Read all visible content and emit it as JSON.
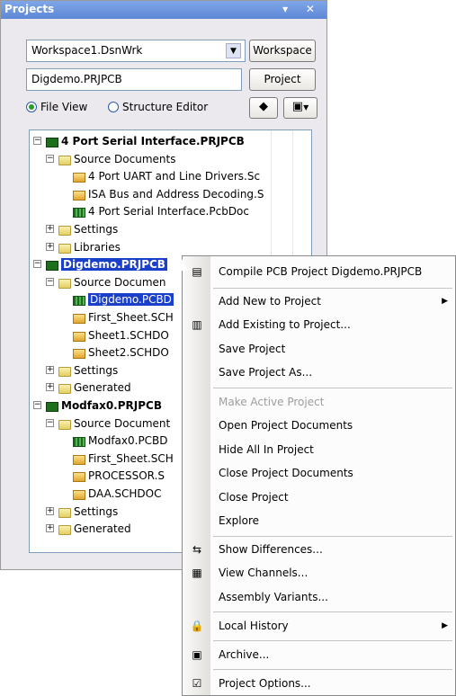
{
  "panel": {
    "title": "Projects",
    "controls": "▾ ✕",
    "workspace_value": "Workspace1.DsnWrk",
    "workspace_button": "Workspace",
    "project_value": "Digdemo.PRJPCB",
    "project_button": "Project",
    "radio_file_view": "File View",
    "radio_structure_editor": "Structure Editor",
    "file_view_selected": true
  },
  "tree": [
    {
      "label": "4 Port Serial Interface.PRJPCB",
      "icon": "prj",
      "level": 0,
      "toggle": "−",
      "bold": true
    },
    {
      "label": "Source Documents",
      "icon": "folder",
      "level": 1,
      "toggle": "−"
    },
    {
      "label": "4 Port UART and Line Drivers.Sc",
      "icon": "sch",
      "level": 2
    },
    {
      "label": "ISA Bus and Address Decoding.S",
      "icon": "sch",
      "level": 2
    },
    {
      "label": "4 Port Serial Interface.PcbDoc",
      "icon": "pcb",
      "level": 2
    },
    {
      "label": "Settings",
      "icon": "folder",
      "level": 1,
      "toggle": "+"
    },
    {
      "label": "Libraries",
      "icon": "folder",
      "level": 1,
      "toggle": "+"
    },
    {
      "label": "Digdemo.PRJPCB",
      "icon": "prj",
      "level": 0,
      "toggle": "−",
      "bold": true,
      "selected": true
    },
    {
      "label": "Source Documen",
      "icon": "folder",
      "level": 1,
      "toggle": "−"
    },
    {
      "label": "Digdemo.PCBD",
      "icon": "pcb",
      "level": 2,
      "selected": true
    },
    {
      "label": "First_Sheet.SCH",
      "icon": "sch",
      "level": 2
    },
    {
      "label": "Sheet1.SCHDO",
      "icon": "sch",
      "level": 2
    },
    {
      "label": "Sheet2.SCHDO",
      "icon": "sch",
      "level": 2
    },
    {
      "label": "Settings",
      "icon": "folder",
      "level": 1,
      "toggle": "+"
    },
    {
      "label": "Generated",
      "icon": "folder",
      "level": 1,
      "toggle": "+"
    },
    {
      "label": "Modfax0.PRJPCB",
      "icon": "prj",
      "level": 0,
      "toggle": "−",
      "bold": true
    },
    {
      "label": "Source Document",
      "icon": "folder",
      "level": 1,
      "toggle": "−"
    },
    {
      "label": "Modfax0.PCBD",
      "icon": "pcb",
      "level": 2
    },
    {
      "label": "First_Sheet.SCH",
      "icon": "sch",
      "level": 2
    },
    {
      "label": "PROCESSOR.S",
      "icon": "sch",
      "level": 2
    },
    {
      "label": "DAA.SCHDOC",
      "icon": "sch",
      "level": 2
    },
    {
      "label": "Settings",
      "icon": "folder",
      "level": 1,
      "toggle": "+"
    },
    {
      "label": "Generated",
      "icon": "folder",
      "level": 1,
      "toggle": "+"
    }
  ],
  "menu": {
    "compile": "Compile PCB Project Digdemo.PRJPCB",
    "add_new": "Add New to Project",
    "add_existing": "Add Existing to Project...",
    "save": "Save Project",
    "save_as": "Save Project As...",
    "make_active": "Make Active Project",
    "open_docs": "Open Project Documents",
    "hide_all": "Hide All In Project",
    "close_docs": "Close Project Documents",
    "close_project": "Close Project",
    "explore": "Explore",
    "show_diff": "Show Differences...",
    "view_channels": "View Channels...",
    "assembly_variants": "Assembly Variants...",
    "local_history": "Local History",
    "archive": "Archive...",
    "project_options": "Project Options..."
  }
}
